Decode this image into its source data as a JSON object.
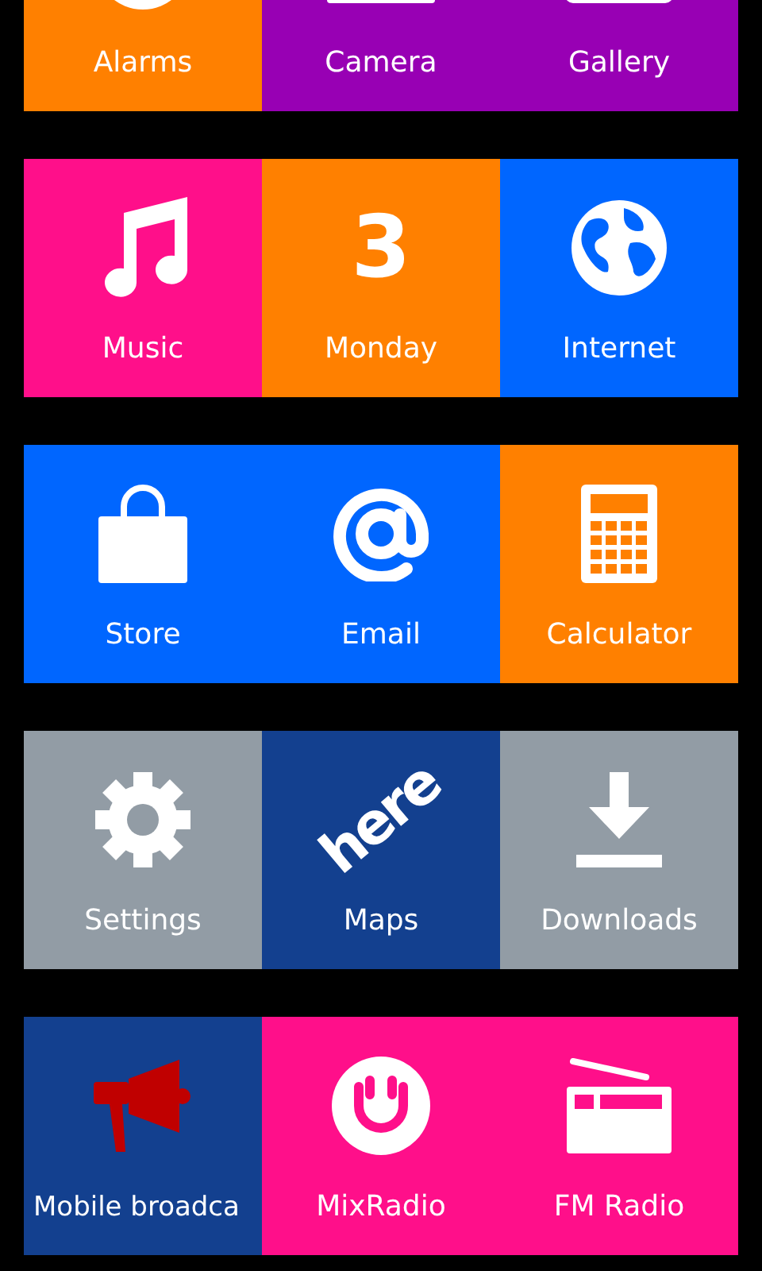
{
  "rows": [
    {
      "tiles": [
        {
          "label": "Alarms",
          "color": "#ff8000"
        },
        {
          "label": "Camera",
          "color": "#9800b4"
        },
        {
          "label": "Gallery",
          "color": "#9800b4"
        }
      ]
    },
    {
      "tiles": [
        {
          "label": "Music",
          "color": "#ff0f8a"
        },
        {
          "label": "Monday",
          "color": "#ff8000",
          "glyph": "3"
        },
        {
          "label": "Internet",
          "color": "#0066ff"
        }
      ]
    },
    {
      "tiles": [
        {
          "label": "Store",
          "color": "#0066ff"
        },
        {
          "label": "Email",
          "color": "#0066ff"
        },
        {
          "label": "Calculator",
          "color": "#ff8000"
        }
      ]
    },
    {
      "tiles": [
        {
          "label": "Settings",
          "color": "#929ca5"
        },
        {
          "label": "Maps",
          "color": "#13408f",
          "glyph": "here"
        },
        {
          "label": "Downloads",
          "color": "#929ca5"
        }
      ]
    },
    {
      "tiles": [
        {
          "label": "Mobile broadca",
          "color": "#13408f"
        },
        {
          "label": "MixRadio",
          "color": "#ff0f8a"
        },
        {
          "label": "FM Radio",
          "color": "#ff0f8a"
        }
      ]
    }
  ]
}
